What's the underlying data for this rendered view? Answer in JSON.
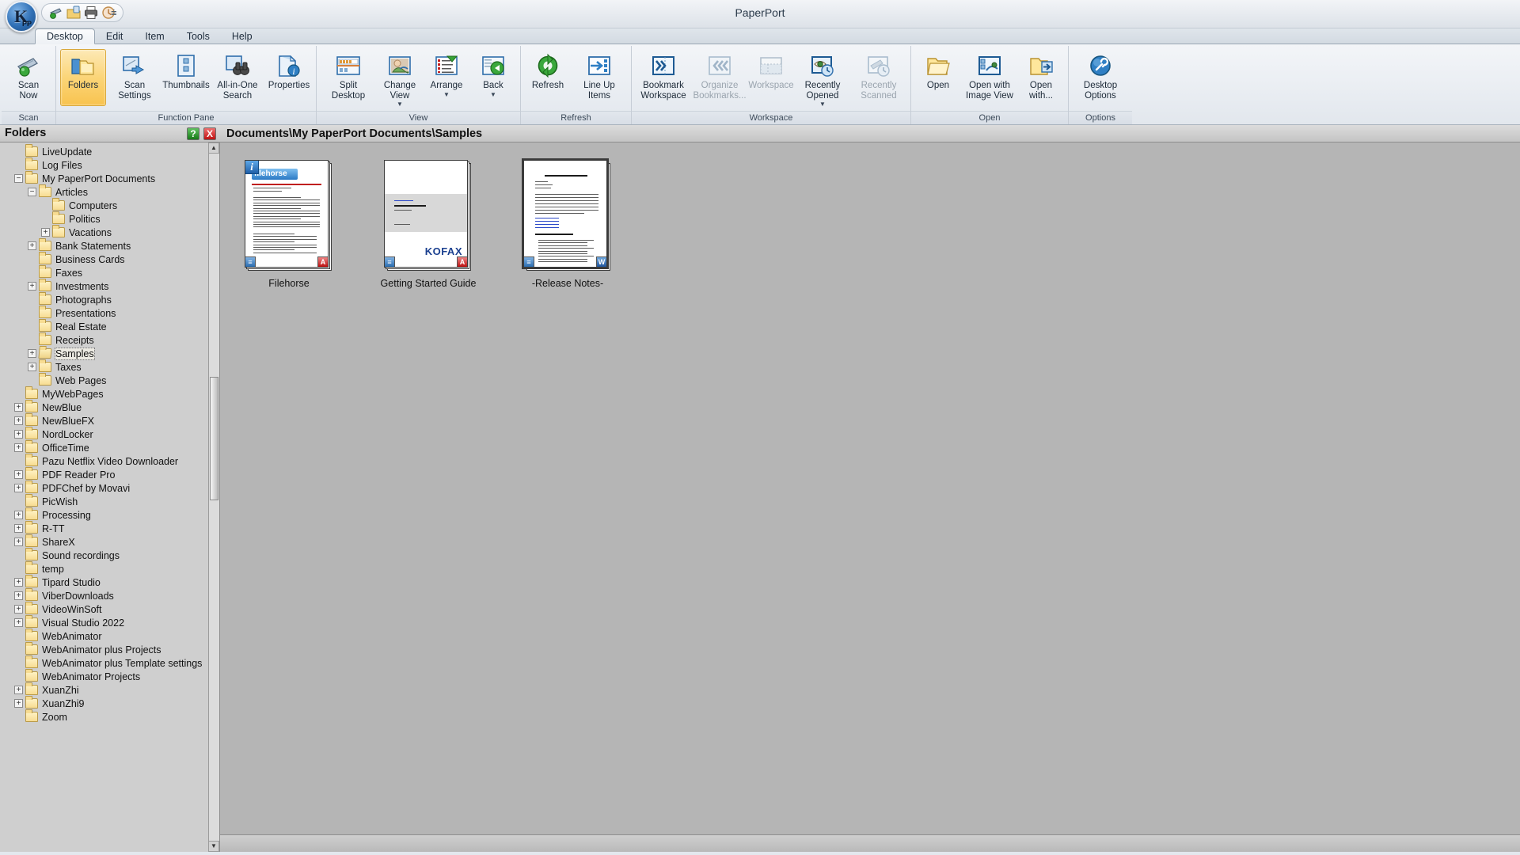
{
  "window": {
    "title": "PaperPort",
    "app_icon": "paperport-orb-icon",
    "qat": [
      {
        "name": "scan-icon",
        "label": "Scan"
      },
      {
        "name": "save-as-icon",
        "label": "Save As"
      },
      {
        "name": "print-icon",
        "label": "Print"
      },
      {
        "name": "undo-icon",
        "label": "Undo"
      }
    ],
    "qat_more": "customize-quick-access-caret"
  },
  "tabs": [
    {
      "label": "Desktop",
      "active": true
    },
    {
      "label": "Edit",
      "active": false
    },
    {
      "label": "Item",
      "active": false
    },
    {
      "label": "Tools",
      "active": false
    },
    {
      "label": "Help",
      "active": false
    }
  ],
  "ribbon": {
    "groups": [
      {
        "label": "Scan",
        "buttons": [
          {
            "label": "Scan\nNow",
            "icon": "scanner-green-icon",
            "active": false,
            "disabled": false,
            "caret": false
          }
        ]
      },
      {
        "label": "Function Pane",
        "buttons": [
          {
            "label": "Folders",
            "icon": "folders-icon",
            "active": true,
            "disabled": false,
            "caret": false
          },
          {
            "label": "Scan\nSettings",
            "icon": "scan-settings-icon",
            "active": false,
            "disabled": false,
            "caret": false
          },
          {
            "label": "Thumbnails",
            "icon": "thumbnails-icon",
            "active": false,
            "disabled": false,
            "caret": false
          },
          {
            "label": "All-in-One\nSearch",
            "icon": "binoculars-search-icon",
            "active": false,
            "disabled": false,
            "caret": false
          },
          {
            "label": "Properties",
            "icon": "properties-info-icon",
            "active": false,
            "disabled": false,
            "caret": false
          }
        ]
      },
      {
        "label": "View",
        "buttons": [
          {
            "label": "Split\nDesktop",
            "icon": "split-desktop-icon",
            "active": false,
            "disabled": false,
            "caret": false
          },
          {
            "label": "Change\nView",
            "icon": "change-view-icon",
            "active": false,
            "disabled": false,
            "caret": true
          },
          {
            "label": "Arrange",
            "icon": "arrange-icon",
            "active": false,
            "disabled": false,
            "caret": true
          },
          {
            "label": "Back",
            "icon": "back-arrow-icon",
            "active": false,
            "disabled": false,
            "caret": true
          }
        ]
      },
      {
        "label": "Refresh",
        "buttons": [
          {
            "label": "Refresh",
            "icon": "refresh-icon",
            "active": false,
            "disabled": false,
            "caret": false
          },
          {
            "label": "Line Up\nItems",
            "icon": "line-up-items-icon",
            "active": false,
            "disabled": false,
            "caret": false
          }
        ]
      },
      {
        "label": "Workspace",
        "buttons": [
          {
            "label": "Bookmark\nWorkspace",
            "icon": "bookmark-workspace-icon",
            "active": false,
            "disabled": false,
            "caret": false
          },
          {
            "label": "Organize\nBookmarks...",
            "icon": "organize-bookmarks-icon",
            "active": false,
            "disabled": true,
            "caret": false
          },
          {
            "label": "Workspace",
            "icon": "workspace-icon",
            "active": false,
            "disabled": true,
            "caret": false
          },
          {
            "label": "Recently\nOpened",
            "icon": "recently-opened-icon",
            "active": false,
            "disabled": false,
            "caret": true
          },
          {
            "label": "Recently\nScanned",
            "icon": "recently-scanned-icon",
            "active": false,
            "disabled": true,
            "caret": false
          }
        ]
      },
      {
        "label": "Open",
        "buttons": [
          {
            "label": "Open",
            "icon": "open-folder-icon",
            "active": false,
            "disabled": false,
            "caret": false
          },
          {
            "label": "Open with\nImage View",
            "icon": "open-image-view-icon",
            "active": false,
            "disabled": false,
            "caret": false
          },
          {
            "label": "Open\nwith...",
            "icon": "open-with-icon",
            "active": false,
            "disabled": false,
            "caret": false
          }
        ]
      },
      {
        "label": "Options",
        "buttons": [
          {
            "label": "Desktop\nOptions",
            "icon": "desktop-options-icon",
            "active": false,
            "disabled": false,
            "caret": false
          }
        ]
      }
    ]
  },
  "folders_pane": {
    "title": "Folders",
    "help_button": "?",
    "close_button": "X",
    "scroll_up": "▲",
    "scroll_down": "▼",
    "tree": [
      {
        "label": "LiveUpdate",
        "depth": 1,
        "toggle": "none",
        "open": false,
        "selected": false
      },
      {
        "label": "Log Files",
        "depth": 1,
        "toggle": "none",
        "open": false,
        "selected": false
      },
      {
        "label": "My PaperPort Documents",
        "depth": 1,
        "toggle": "minus",
        "open": false,
        "selected": false
      },
      {
        "label": "Articles",
        "depth": 2,
        "toggle": "minus",
        "open": false,
        "selected": false
      },
      {
        "label": "Computers",
        "depth": 3,
        "toggle": "none",
        "open": false,
        "selected": false
      },
      {
        "label": "Politics",
        "depth": 3,
        "toggle": "none",
        "open": false,
        "selected": false
      },
      {
        "label": "Vacations",
        "depth": 3,
        "toggle": "plus",
        "open": false,
        "selected": false
      },
      {
        "label": "Bank Statements",
        "depth": 2,
        "toggle": "plus",
        "open": false,
        "selected": false
      },
      {
        "label": "Business Cards",
        "depth": 2,
        "toggle": "none",
        "open": false,
        "selected": false
      },
      {
        "label": "Faxes",
        "depth": 2,
        "toggle": "none",
        "open": false,
        "selected": false
      },
      {
        "label": "Investments",
        "depth": 2,
        "toggle": "plus",
        "open": false,
        "selected": false
      },
      {
        "label": "Photographs",
        "depth": 2,
        "toggle": "none",
        "open": false,
        "selected": false
      },
      {
        "label": "Presentations",
        "depth": 2,
        "toggle": "none",
        "open": false,
        "selected": false
      },
      {
        "label": "Real Estate",
        "depth": 2,
        "toggle": "none",
        "open": false,
        "selected": false
      },
      {
        "label": "Receipts",
        "depth": 2,
        "toggle": "none",
        "open": false,
        "selected": false
      },
      {
        "label": "Samples",
        "depth": 2,
        "toggle": "plus",
        "open": true,
        "selected": true
      },
      {
        "label": "Taxes",
        "depth": 2,
        "toggle": "plus",
        "open": false,
        "selected": false
      },
      {
        "label": "Web Pages",
        "depth": 2,
        "toggle": "none",
        "open": false,
        "selected": false
      },
      {
        "label": "MyWebPages",
        "depth": 1,
        "toggle": "none",
        "open": false,
        "selected": false
      },
      {
        "label": "NewBlue",
        "depth": 1,
        "toggle": "plus",
        "open": false,
        "selected": false
      },
      {
        "label": "NewBlueFX",
        "depth": 1,
        "toggle": "plus",
        "open": false,
        "selected": false
      },
      {
        "label": "NordLocker",
        "depth": 1,
        "toggle": "plus",
        "open": false,
        "selected": false
      },
      {
        "label": "OfficeTime",
        "depth": 1,
        "toggle": "plus",
        "open": false,
        "selected": false
      },
      {
        "label": "Pazu Netflix Video Downloader",
        "depth": 1,
        "toggle": "none",
        "open": false,
        "selected": false
      },
      {
        "label": "PDF Reader Pro",
        "depth": 1,
        "toggle": "plus",
        "open": false,
        "selected": false
      },
      {
        "label": "PDFChef by Movavi",
        "depth": 1,
        "toggle": "plus",
        "open": false,
        "selected": false
      },
      {
        "label": "PicWish",
        "depth": 1,
        "toggle": "none",
        "open": false,
        "selected": false
      },
      {
        "label": "Processing",
        "depth": 1,
        "toggle": "plus",
        "open": false,
        "selected": false
      },
      {
        "label": "R-TT",
        "depth": 1,
        "toggle": "plus",
        "open": false,
        "selected": false
      },
      {
        "label": "ShareX",
        "depth": 1,
        "toggle": "plus",
        "open": false,
        "selected": false
      },
      {
        "label": "Sound recordings",
        "depth": 1,
        "toggle": "none",
        "open": false,
        "selected": false
      },
      {
        "label": "temp",
        "depth": 1,
        "toggle": "none",
        "open": false,
        "selected": false
      },
      {
        "label": "Tipard Studio",
        "depth": 1,
        "toggle": "plus",
        "open": false,
        "selected": false
      },
      {
        "label": "ViberDownloads",
        "depth": 1,
        "toggle": "plus",
        "open": false,
        "selected": false
      },
      {
        "label": "VideoWinSoft",
        "depth": 1,
        "toggle": "plus",
        "open": false,
        "selected": false
      },
      {
        "label": "Visual Studio 2022",
        "depth": 1,
        "toggle": "plus",
        "open": false,
        "selected": false
      },
      {
        "label": "WebAnimator",
        "depth": 1,
        "toggle": "none",
        "open": false,
        "selected": false
      },
      {
        "label": "WebAnimator plus Projects",
        "depth": 1,
        "toggle": "none",
        "open": false,
        "selected": false
      },
      {
        "label": "WebAnimator plus Template settings",
        "depth": 1,
        "toggle": "none",
        "open": false,
        "selected": false
      },
      {
        "label": "WebAnimator Projects",
        "depth": 1,
        "toggle": "none",
        "open": false,
        "selected": false
      },
      {
        "label": "XuanZhi",
        "depth": 1,
        "toggle": "plus",
        "open": false,
        "selected": false
      },
      {
        "label": "XuanZhi9",
        "depth": 1,
        "toggle": "plus",
        "open": false,
        "selected": false
      },
      {
        "label": "Zoom",
        "depth": 1,
        "toggle": "none",
        "open": false,
        "selected": false
      }
    ]
  },
  "desktop": {
    "breadcrumb": "Documents\\My PaperPort Documents\\Samples",
    "items": [
      {
        "label": "-Release Notes-",
        "doc_kind": "word",
        "badge_left": "page-count-badge",
        "badge_right": "word-document-badge",
        "selected": true,
        "preview_title": "Release Notes for PaperPort 14"
      },
      {
        "label": "Getting Started Guide",
        "doc_kind": "pdf",
        "badge_left": "page-count-badge",
        "badge_right": "pdf-document-badge",
        "selected": false,
        "preview_title": "PaperPort Getting Started Guide",
        "brand": "KOFAX"
      },
      {
        "label": "Filehorse",
        "doc_kind": "pdf",
        "badge_left": "page-count-badge",
        "badge_right": "pdf-document-badge",
        "selected": false,
        "preview_title": "filehorse",
        "info_badge": "i"
      }
    ]
  },
  "colors": {
    "accent_blue": "#2f6eab",
    "folder_yellow": "#f7dc92",
    "active_button": "#fbd578",
    "pdf_red": "#bb1212",
    "brand_kofax": "#1a3f8f"
  }
}
